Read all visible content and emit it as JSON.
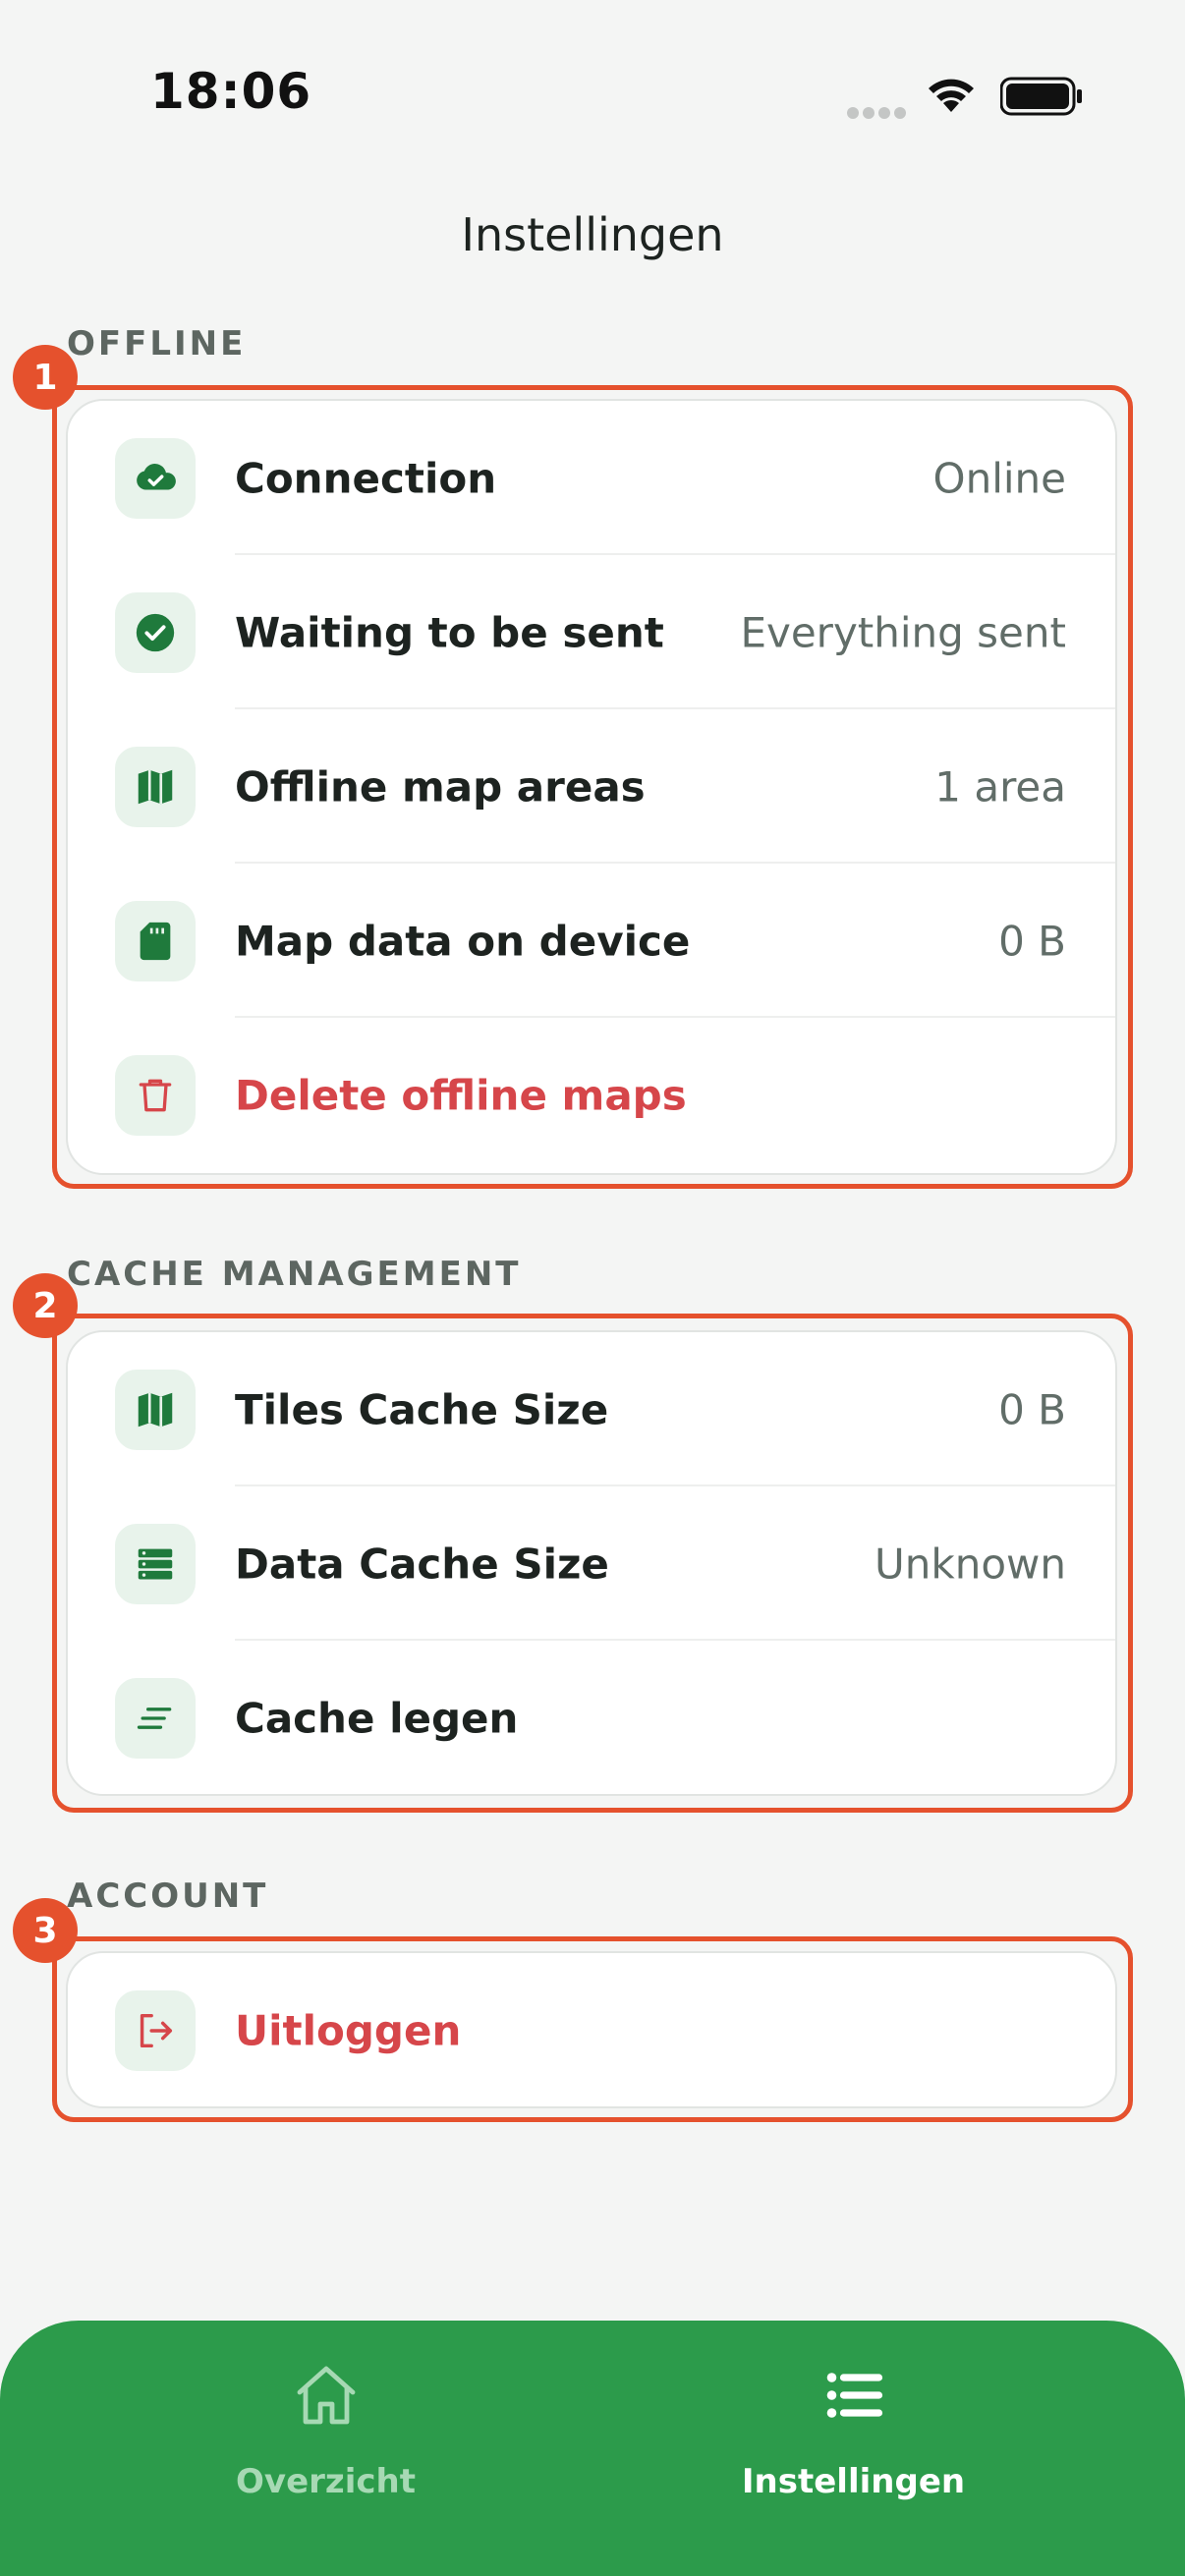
{
  "status_bar": {
    "time": "18:06"
  },
  "title": "Instellingen",
  "sections": {
    "offline": {
      "header": "OFFLINE",
      "marker": "1",
      "rows": [
        {
          "label": "Connection",
          "value": "Online",
          "icon": "cloud-check-icon"
        },
        {
          "label": "Waiting to be sent",
          "value": "Everything sent",
          "icon": "check-circle-icon"
        },
        {
          "label": "Offline map areas",
          "value": "1 area",
          "icon": "map-icon"
        },
        {
          "label": "Map data on device",
          "value": "0 B",
          "icon": "sd-card-icon"
        },
        {
          "label": "Delete offline maps",
          "icon": "trash-icon"
        }
      ]
    },
    "cache": {
      "header": "CACHE MANAGEMENT",
      "marker": "2",
      "rows": [
        {
          "label": "Tiles Cache Size",
          "value": "0 B",
          "icon": "map-icon"
        },
        {
          "label": "Data Cache Size",
          "value": "Unknown",
          "icon": "database-icon"
        },
        {
          "label": "Cache legen",
          "icon": "clear-lines-icon"
        }
      ]
    },
    "account": {
      "header": "ACCOUNT",
      "marker": "3",
      "rows": [
        {
          "label": "Uitloggen",
          "icon": "logout-icon"
        }
      ]
    }
  },
  "tab_bar": {
    "tabs": [
      {
        "label": "Overzicht",
        "icon": "home-icon",
        "active": false
      },
      {
        "label": "Instellingen",
        "icon": "list-icon",
        "active": true
      }
    ]
  },
  "colors": {
    "accent_green": "#2c9b4b",
    "icon_green": "#1f7a3c",
    "danger_red": "#d6464a",
    "highlight_orange": "#e5512d"
  }
}
